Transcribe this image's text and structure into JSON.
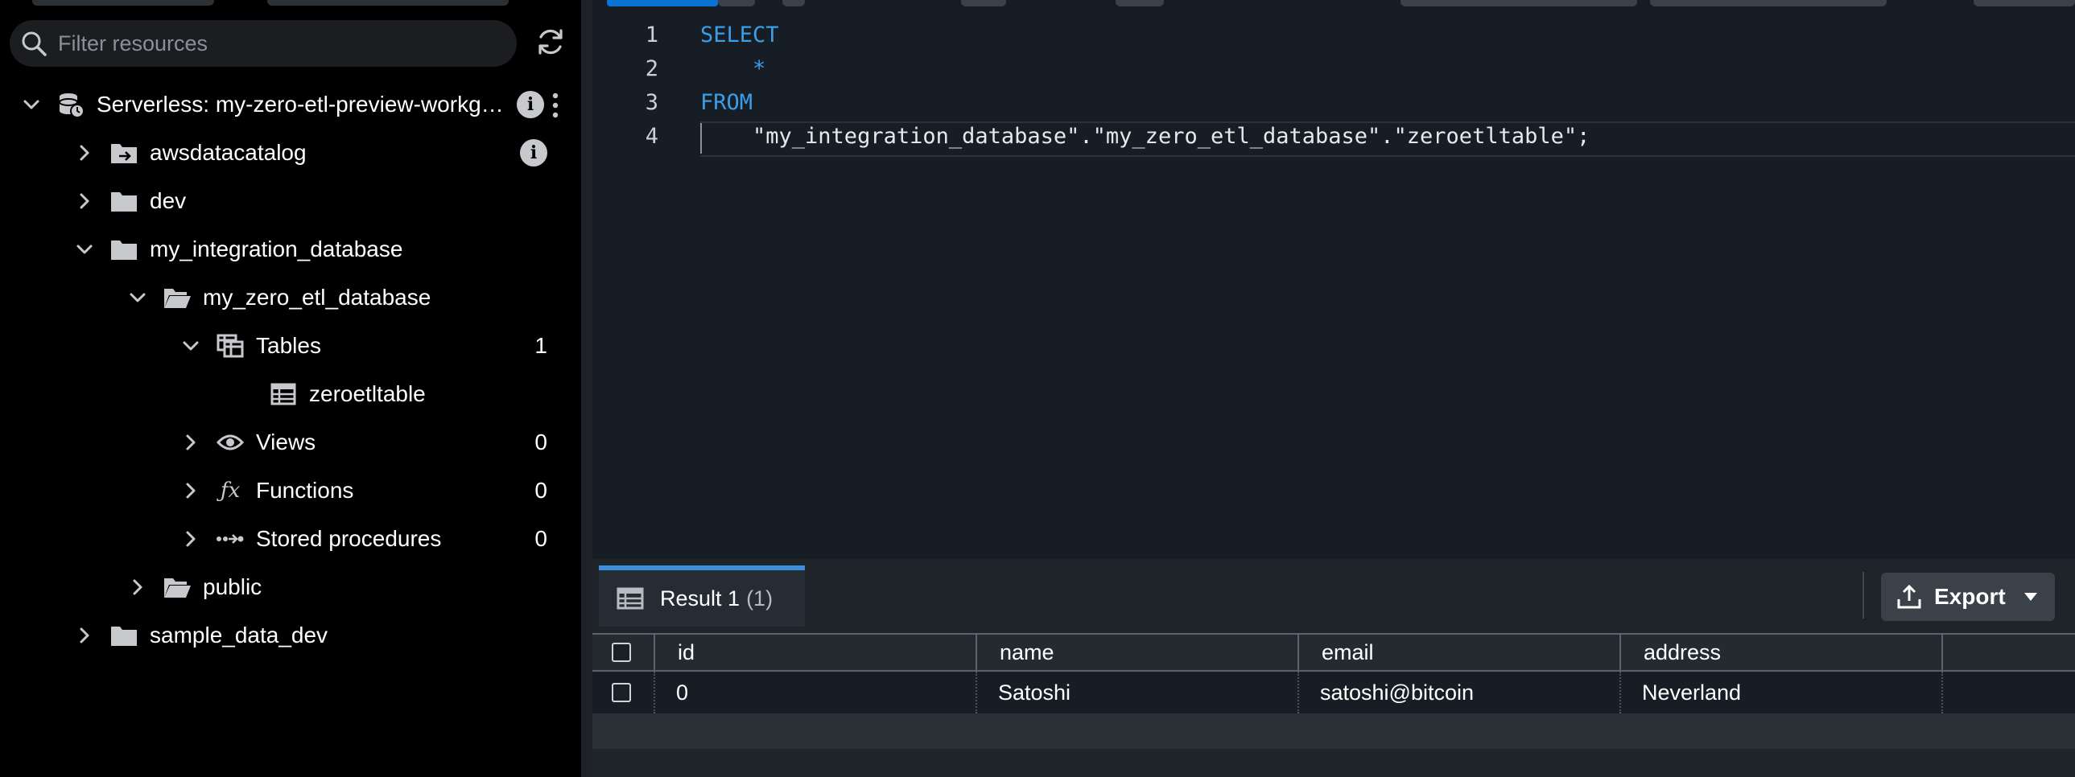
{
  "sidebar": {
    "search": {
      "placeholder": "Filter resources"
    },
    "tree": {
      "connection": "Serverless: my-zero-etl-preview-workg…",
      "awsdatacatalog": "awsdatacatalog",
      "dev": "dev",
      "my_integration_database": "my_integration_database",
      "my_zero_etl_database": "my_zero_etl_database",
      "tables": {
        "label": "Tables",
        "count": "1"
      },
      "zeroetltable": "zeroetltable",
      "views": {
        "label": "Views",
        "count": "0"
      },
      "functions": {
        "label": "Functions",
        "count": "0"
      },
      "stored_procedures": {
        "label": "Stored procedures",
        "count": "0"
      },
      "public": "public",
      "sample_data_dev": "sample_data_dev"
    }
  },
  "editor": {
    "lines": [
      {
        "num": "1",
        "text": "SELECT"
      },
      {
        "num": "2",
        "text": "    *"
      },
      {
        "num": "3",
        "text": "FROM"
      },
      {
        "num": "4",
        "text": "    \"my_integration_database\".\"my_zero_etl_database\".\"zeroetltable\";"
      }
    ],
    "keyword_color": "#3b9ee8"
  },
  "results": {
    "tab": {
      "label": "Result 1",
      "count": "(1)"
    },
    "export_label": "Export",
    "columns": [
      "id",
      "name",
      "email",
      "address"
    ],
    "rows": [
      [
        "0",
        "Satoshi",
        "satoshi@bitcoin",
        "Neverland"
      ]
    ]
  },
  "colors": {
    "accent": "#0972d3",
    "tab_accent": "#3b8fdd",
    "editor_bg": "#161d25",
    "sidebar_bg": "#000000"
  }
}
